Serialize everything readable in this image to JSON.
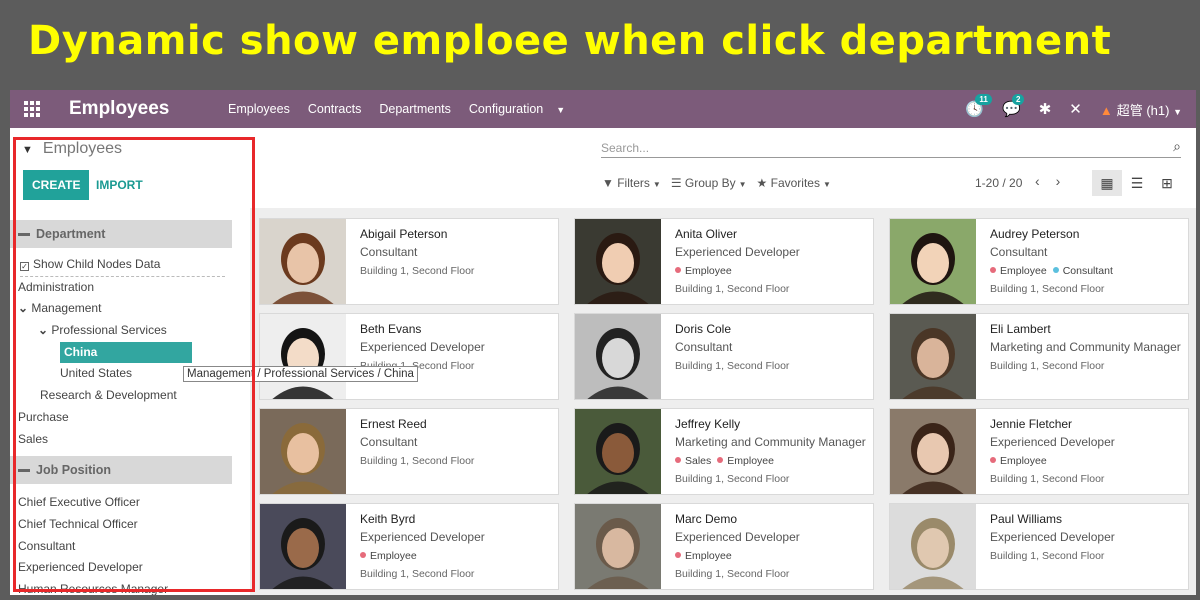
{
  "banner": "Dynamic show emploee when click department",
  "topbar": {
    "brand": "Employees",
    "menu": [
      "Employees",
      "Contracts",
      "Departments",
      "Configuration"
    ],
    "activity_count": "11",
    "message_count": "2",
    "user": "超管 (h1)"
  },
  "control": {
    "title": "Employees",
    "create_label": "CREATE",
    "import_label": "IMPORT",
    "search_placeholder": "Search...",
    "filters_label": "Filters",
    "groupby_label": "Group By",
    "favorites_label": "Favorites",
    "pager": "1-20 / 20"
  },
  "sidebar": {
    "department_header": "Department",
    "show_child_label": "Show Child Nodes Data",
    "departments": [
      {
        "label": "Administration",
        "level": 0,
        "expanded": false,
        "selected": false
      },
      {
        "label": "Management",
        "level": 0,
        "expanded": true,
        "selected": false
      },
      {
        "label": "Professional Services",
        "level": 1,
        "expanded": true,
        "selected": false
      },
      {
        "label": "China",
        "level": 2,
        "expanded": false,
        "selected": true
      },
      {
        "label": "United States",
        "level": 2,
        "expanded": false,
        "selected": false
      },
      {
        "label": "Research & Development",
        "level": 1,
        "expanded": false,
        "selected": false
      },
      {
        "label": "Purchase",
        "level": 0,
        "expanded": false,
        "selected": false
      },
      {
        "label": "Sales",
        "level": 0,
        "expanded": false,
        "selected": false
      }
    ],
    "tooltip": "Management / Professional Services / China",
    "job_header": "Job Position",
    "jobs": [
      "Chief Executive Officer",
      "Chief Technical Officer",
      "Consultant",
      "Experienced Developer",
      "Human Resources Manager"
    ]
  },
  "colors": {
    "tag_employee": "#e66b7b",
    "tag_consultant": "#5bc0de",
    "tag_sales": "#e66b7b",
    "accent": "#21a29a",
    "topbar": "#7c5b7a"
  },
  "employees": [
    {
      "name": "Abigail Peterson",
      "job": "Consultant",
      "tags": [],
      "location": "Building 1, Second Floor",
      "skin": "#e8c4a8",
      "hair": "#6b3a1e",
      "bg": "#d9d4cc"
    },
    {
      "name": "Anita Oliver",
      "job": "Experienced Developer",
      "tags": [
        "Employee"
      ],
      "location": "Building 1, Second Floor",
      "skin": "#f0cdb2",
      "hair": "#2a1a12",
      "bg": "#3a3a32"
    },
    {
      "name": "Audrey Peterson",
      "job": "Consultant",
      "tags": [
        "Employee",
        "Consultant"
      ],
      "location": "Building 1, Second Floor",
      "skin": "#f2d3b8",
      "hair": "#1f1510",
      "bg": "#8aa86a"
    },
    {
      "name": "Beth Evans",
      "job": "Experienced Developer",
      "tags": [],
      "location": "Building 1, Second Floor",
      "skin": "#f3dcc8",
      "hair": "#141414",
      "bg": "#eeeeee"
    },
    {
      "name": "Doris Cole",
      "job": "Consultant",
      "tags": [],
      "location": "Building 1, Second Floor",
      "skin": "#d8d8d8",
      "hair": "#222222",
      "bg": "#bdbdbd"
    },
    {
      "name": "Eli Lambert",
      "job": "Marketing and Community Manager",
      "tags": [],
      "location": "Building 1, Second Floor",
      "skin": "#d9b49a",
      "hair": "#4a3626",
      "bg": "#5a5a52"
    },
    {
      "name": "Ernest Reed",
      "job": "Consultant",
      "tags": [],
      "location": "Building 1, Second Floor",
      "skin": "#e8c0a0",
      "hair": "#8a6a3a",
      "bg": "#7a6a5a"
    },
    {
      "name": "Jeffrey Kelly",
      "job": "Marketing and Community Manager",
      "tags": [
        "Sales",
        "Employee"
      ],
      "location": "Building 1, Second Floor",
      "skin": "#8a5a3a",
      "hair": "#1a1a1a",
      "bg": "#4a5a3a"
    },
    {
      "name": "Jennie Fletcher",
      "job": "Experienced Developer",
      "tags": [
        "Employee"
      ],
      "location": "Building 1, Second Floor",
      "skin": "#e8c8b0",
      "hair": "#3a2418",
      "bg": "#8a7a6a"
    },
    {
      "name": "Keith Byrd",
      "job": "Experienced Developer",
      "tags": [
        "Employee"
      ],
      "location": "Building 1, Second Floor",
      "skin": "#9a6a4a",
      "hair": "#1a1a1a",
      "bg": "#4a4a5a"
    },
    {
      "name": "Marc Demo",
      "job": "Experienced Developer",
      "tags": [
        "Employee"
      ],
      "location": "Building 1, Second Floor",
      "skin": "#d8b8a0",
      "hair": "#6a5a4a",
      "bg": "#7a7a72"
    },
    {
      "name": "Paul Williams",
      "job": "Experienced Developer",
      "tags": [],
      "location": "Building 1, Second Floor",
      "skin": "#e0c8b0",
      "hair": "#9a8a6a",
      "bg": "#dcdcdc"
    }
  ]
}
